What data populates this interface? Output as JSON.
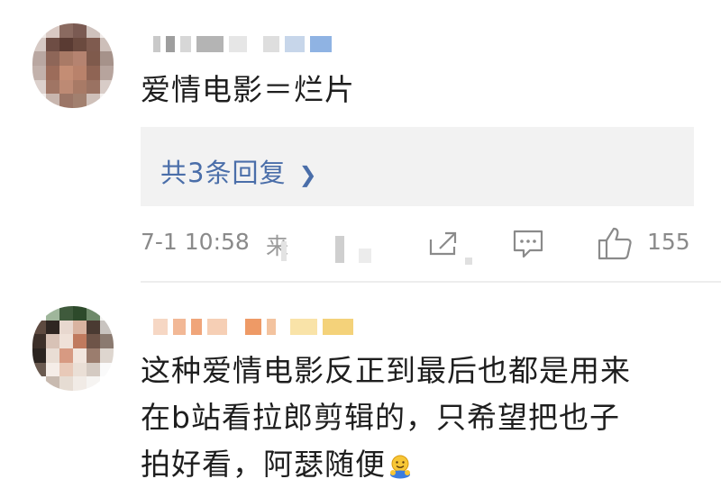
{
  "comments": [
    {
      "text": "爱情电影＝烂片",
      "reply_link": "共3条回复",
      "timestamp": "7-1 10:58",
      "source_fragment": "来",
      "like_count": "155"
    },
    {
      "text_lines": [
        "这种爱情电影反正到最后也都是用来",
        "在b站看拉郎剪辑的，只希望把也子",
        "拍好看，阿瑟随便"
      ],
      "emoji": "hug-emoji"
    }
  ],
  "colors": {
    "reply_link": "#4a6ea9",
    "meta_text": "#8a8a8a",
    "reply_background": "#f2f2f2"
  }
}
